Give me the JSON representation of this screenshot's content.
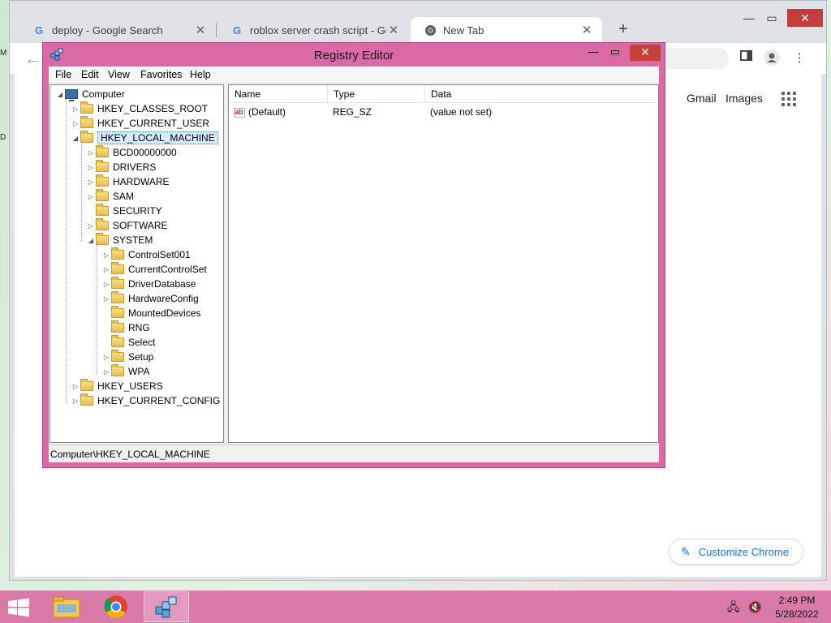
{
  "chrome": {
    "tabs": [
      {
        "title": "deploy - Google Search",
        "icon": "google-g-icon"
      },
      {
        "title": "roblox server crash script - Goog",
        "icon": "google-g-icon"
      },
      {
        "title": "New Tab",
        "icon": "chrome-icon"
      }
    ],
    "close_glyph": "✕",
    "newtab_glyph": "+",
    "page": {
      "gmail": "Gmail",
      "images": "Images",
      "customize": "Customize Chrome"
    }
  },
  "regedit": {
    "title": "Registry Editor",
    "menu": [
      "File",
      "Edit",
      "View",
      "Favorites",
      "Help"
    ],
    "tree": {
      "root": "Computer",
      "hives": {
        "classes_root": "HKEY_CLASSES_ROOT",
        "current_user": "HKEY_CURRENT_USER",
        "local_machine": "HKEY_LOCAL_MACHINE",
        "users": "HKEY_USERS",
        "current_config": "HKEY_CURRENT_CONFIG"
      },
      "hklm_children": [
        "BCD00000000",
        "DRIVERS",
        "HARDWARE",
        "SAM",
        "SECURITY",
        "SOFTWARE",
        "SYSTEM"
      ],
      "system_children": [
        "ControlSet001",
        "CurrentControlSet",
        "DriverDatabase",
        "HardwareConfig",
        "MountedDevices",
        "RNG",
        "Select",
        "Setup",
        "WPA"
      ]
    },
    "columns": {
      "name": "Name",
      "type": "Type",
      "data": "Data"
    },
    "values": [
      {
        "name": "(Default)",
        "type": "REG_SZ",
        "data": "(value not set)"
      }
    ],
    "status": "Computer\\HKEY_LOCAL_MACHINE"
  },
  "taskbar": {
    "time": "2:49 PM",
    "date": "5/28/2022"
  },
  "colors": {
    "regedit_frame": "#d96aa5",
    "taskbar": "#d97aa9",
    "chrome_accent": "#1a73e8"
  }
}
